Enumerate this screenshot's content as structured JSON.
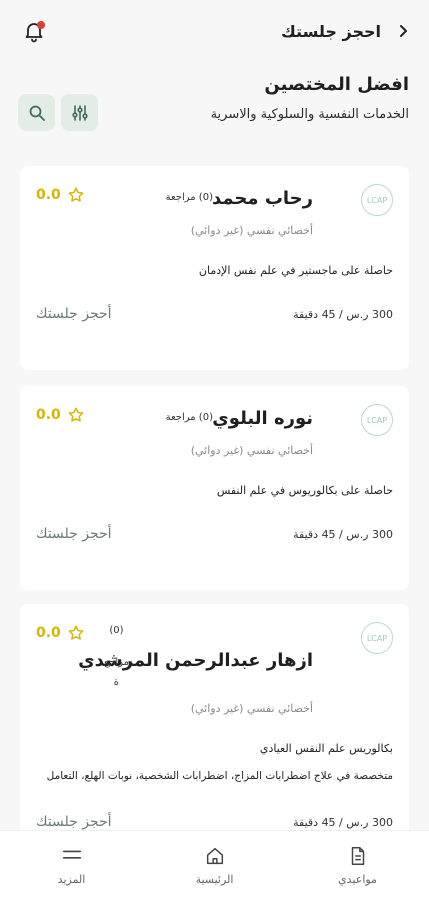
{
  "header": {
    "title": "احجز جلستك"
  },
  "section": {
    "title": "افضل المختصين",
    "subtitle": "الخدمات النفسية والسلوكية والاسرية"
  },
  "specialists": [
    {
      "name": "رحاب محمد",
      "reviews": "(0) مراجعة",
      "rating": "0.0",
      "role": "أخصائي نفسي (غير دوائي)",
      "desc_lines": [
        "حاصلة على ماجستير في علم نفس الإدمان"
      ],
      "price": "300 ر.س / 45 دقيقة",
      "book": "أحجز جلستك",
      "logo": "LCAP"
    },
    {
      "name": "نوره البلوي",
      "reviews": "(0) مراجعة",
      "rating": "0.0",
      "role": "أخصائي نفسي (غير دوائي)",
      "desc_lines": [
        "حاصلة على بكالوريوس في علم النفس"
      ],
      "price": "300 ر.س / 45 دقيقة",
      "book": "أحجز جلستك",
      "logo": "LCAP"
    },
    {
      "name": "ازهار عبدالرحمن المرشدي",
      "reviews_lines": [
        "(0)",
        "مراجع",
        "ة"
      ],
      "rating": "0.0",
      "role": "أخصائي نفسي (غير دوائي)",
      "desc_lines": [
        "بكالوريس علم النفس العيادي",
        "متخصصة في علاج اضطرابات المزاج، اضطرابات الشخصية، نوبات الهلع، التعامل"
      ],
      "price": "300 ر.س / 45 دقيقة",
      "book": "أحجز جلستك",
      "logo": "LCAP"
    }
  ],
  "nav": {
    "appointments": "مواعيدي",
    "home": "الرئيسية",
    "more": "المزيد"
  },
  "colors": {
    "accent_bg": "#e3ede6",
    "star": "#d7b600",
    "notification_dot": "#e53935"
  },
  "icons": [
    "bell-icon",
    "chevron-right-icon",
    "search-icon",
    "filter-icon",
    "star-icon",
    "appointments-icon",
    "home-icon",
    "menu-icon"
  ]
}
